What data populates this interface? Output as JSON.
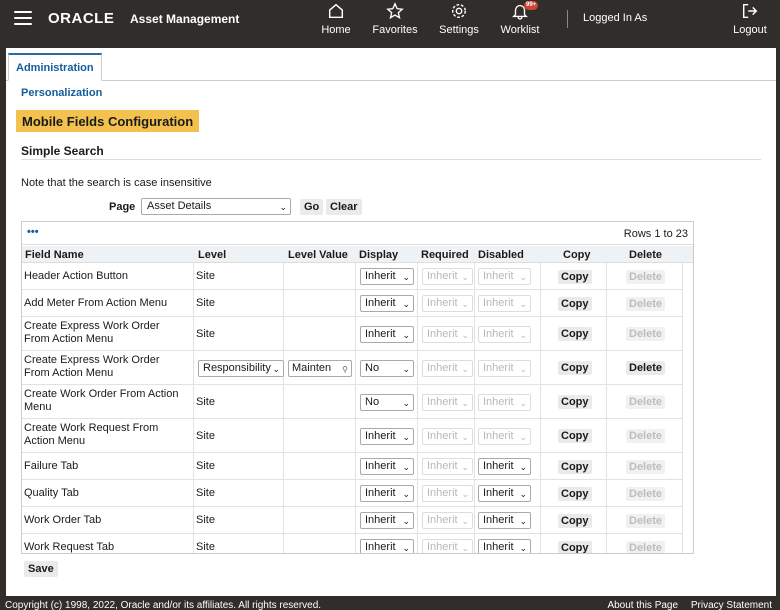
{
  "header": {
    "brand": "ORACLE",
    "app_name": "Asset Management",
    "nav": {
      "home": "Home",
      "favorites": "Favorites",
      "settings": "Settings",
      "worklist": "Worklist",
      "worklist_badge": "99+",
      "logout": "Logout"
    },
    "logged_in": "Logged In As"
  },
  "tabs": {
    "active": "Administration"
  },
  "breadcrumb": "Personalization",
  "page_title": "Mobile Fields Configuration",
  "search": {
    "section_title": "Simple Search",
    "note": "Note that the search is case insensitive",
    "page_label": "Page",
    "page_value": "Asset Details",
    "go": "Go",
    "clear": "Clear"
  },
  "table": {
    "more_icon": "•••",
    "rows_info": "Rows 1 to 23",
    "columns": {
      "field_name": "Field Name",
      "level": "Level",
      "level_value": "Level Value",
      "display": "Display",
      "required": "Required",
      "disabled": "Disabled",
      "copy": "Copy",
      "delete": "Delete"
    },
    "rows": [
      {
        "field": "Header Action Button",
        "level": "Site",
        "level_value": "",
        "display": "Inherit",
        "required": "Inherit",
        "disabled": "Inherit",
        "disabled_enabled": false,
        "copy": "Copy",
        "delete": "Delete",
        "delete_enabled": false
      },
      {
        "field": "Add Meter From Action Menu",
        "level": "Site",
        "level_value": "",
        "display": "Inherit",
        "required": "Inherit",
        "disabled": "Inherit",
        "disabled_enabled": false,
        "copy": "Copy",
        "delete": "Delete",
        "delete_enabled": false
      },
      {
        "field": "Create Express Work Order From Action Menu",
        "level": "Site",
        "level_value": "",
        "display": "Inherit",
        "required": "Inherit",
        "disabled": "Inherit",
        "disabled_enabled": false,
        "copy": "Copy",
        "delete": "Delete",
        "delete_enabled": false
      },
      {
        "field": "Create Express Work Order From Action Menu",
        "level": "Responsibility",
        "level_value": "Mainten",
        "display": "No",
        "required": "Inherit",
        "disabled": "Inherit",
        "disabled_enabled": false,
        "copy": "Copy",
        "delete": "Delete",
        "delete_enabled": true
      },
      {
        "field": "Create Work Order From Action Menu",
        "level": "Site",
        "level_value": "",
        "display": "No",
        "required": "Inherit",
        "disabled": "Inherit",
        "disabled_enabled": false,
        "copy": "Copy",
        "delete": "Delete",
        "delete_enabled": false
      },
      {
        "field": "Create Work Request From Action Menu",
        "level": "Site",
        "level_value": "",
        "display": "Inherit",
        "required": "Inherit",
        "disabled": "Inherit",
        "disabled_enabled": false,
        "copy": "Copy",
        "delete": "Delete",
        "delete_enabled": false
      },
      {
        "field": "Failure Tab",
        "level": "Site",
        "level_value": "",
        "display": "Inherit",
        "required": "Inherit",
        "disabled": "Inherit",
        "disabled_enabled": true,
        "copy": "Copy",
        "delete": "Delete",
        "delete_enabled": false
      },
      {
        "field": "Quality Tab",
        "level": "Site",
        "level_value": "",
        "display": "Inherit",
        "required": "Inherit",
        "disabled": "Inherit",
        "disabled_enabled": true,
        "copy": "Copy",
        "delete": "Delete",
        "delete_enabled": false
      },
      {
        "field": "Work Order Tab",
        "level": "Site",
        "level_value": "",
        "display": "Inherit",
        "required": "Inherit",
        "disabled": "Inherit",
        "disabled_enabled": true,
        "copy": "Copy",
        "delete": "Delete",
        "delete_enabled": false
      },
      {
        "field": "Work Request Tab",
        "level": "Site",
        "level_value": "",
        "display": "Inherit",
        "required": "Inherit",
        "disabled": "Inherit",
        "disabled_enabled": true,
        "copy": "Copy",
        "delete": "Delete",
        "delete_enabled": false
      }
    ]
  },
  "save": "Save",
  "footer": {
    "copyright": "Copyright (c) 1998, 2022, Oracle and/or its affiliates. All rights reserved.",
    "about": "About this Page",
    "privacy": "Privacy Statement"
  },
  "colors": {
    "header_bg": "#312d2a",
    "link_blue": "#145c9e",
    "title_highlight": "#f2c14e",
    "badge_red": "#c74634"
  }
}
